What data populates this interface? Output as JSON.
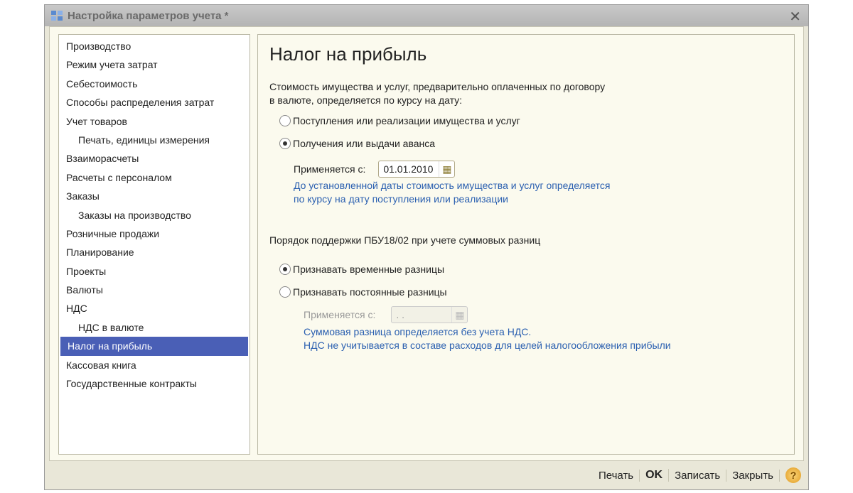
{
  "window": {
    "title": "Настройка параметров учета *"
  },
  "sidebar": {
    "items": [
      {
        "label": "Производство",
        "sub": false
      },
      {
        "label": "Режим учета затрат",
        "sub": false
      },
      {
        "label": "Себестоимость",
        "sub": false
      },
      {
        "label": "Способы распределения затрат",
        "sub": false
      },
      {
        "label": "Учет товаров",
        "sub": false
      },
      {
        "label": "Печать, единицы измерения",
        "sub": true
      },
      {
        "label": "Взаиморасчеты",
        "sub": false
      },
      {
        "label": "Расчеты с персоналом",
        "sub": false
      },
      {
        "label": "Заказы",
        "sub": false
      },
      {
        "label": "Заказы на производство",
        "sub": true
      },
      {
        "label": "Розничные продажи",
        "sub": false
      },
      {
        "label": "Планирование",
        "sub": false
      },
      {
        "label": "Проекты",
        "sub": false
      },
      {
        "label": "Валюты",
        "sub": false
      },
      {
        "label": "НДС",
        "sub": false
      },
      {
        "label": "НДС в валюте",
        "sub": true
      },
      {
        "label": "Налог на прибыль",
        "sub": false,
        "selected": true
      },
      {
        "label": "Кассовая книга",
        "sub": false
      },
      {
        "label": "Государственные контракты",
        "sub": false
      }
    ]
  },
  "main": {
    "title": "Налог на прибыль",
    "section1": {
      "desc1": "Стоимость имущества и услуг, предварительно оплаченных по договору",
      "desc2": "в валюте, определяется по курсу на дату:",
      "option1": "Поступления или реализации имущества и услуг",
      "option2": "Получения или выдачи аванса",
      "selected": 2,
      "date_label": "Применяется с:",
      "date_value": "01.01.2010",
      "note1": "До установленной даты стоимость имущества и услуг определяется",
      "note2": "по курсу на дату поступления или реализации"
    },
    "section2": {
      "desc": "Порядок поддержки ПБУ18/02 при учете суммовых разниц",
      "option1": "Признавать временные разницы",
      "option2": "Признавать постоянные разницы",
      "selected": 1,
      "date_label": "Применяется с:",
      "date_value": " .  .",
      "note1": "Суммовая разница определяется без учета НДС.",
      "note2": "НДС не учитывается в составе расходов для целей налогообложения прибыли"
    }
  },
  "footer": {
    "print": "Печать",
    "ok": "OK",
    "save": "Записать",
    "close": "Закрыть",
    "help": "?"
  }
}
